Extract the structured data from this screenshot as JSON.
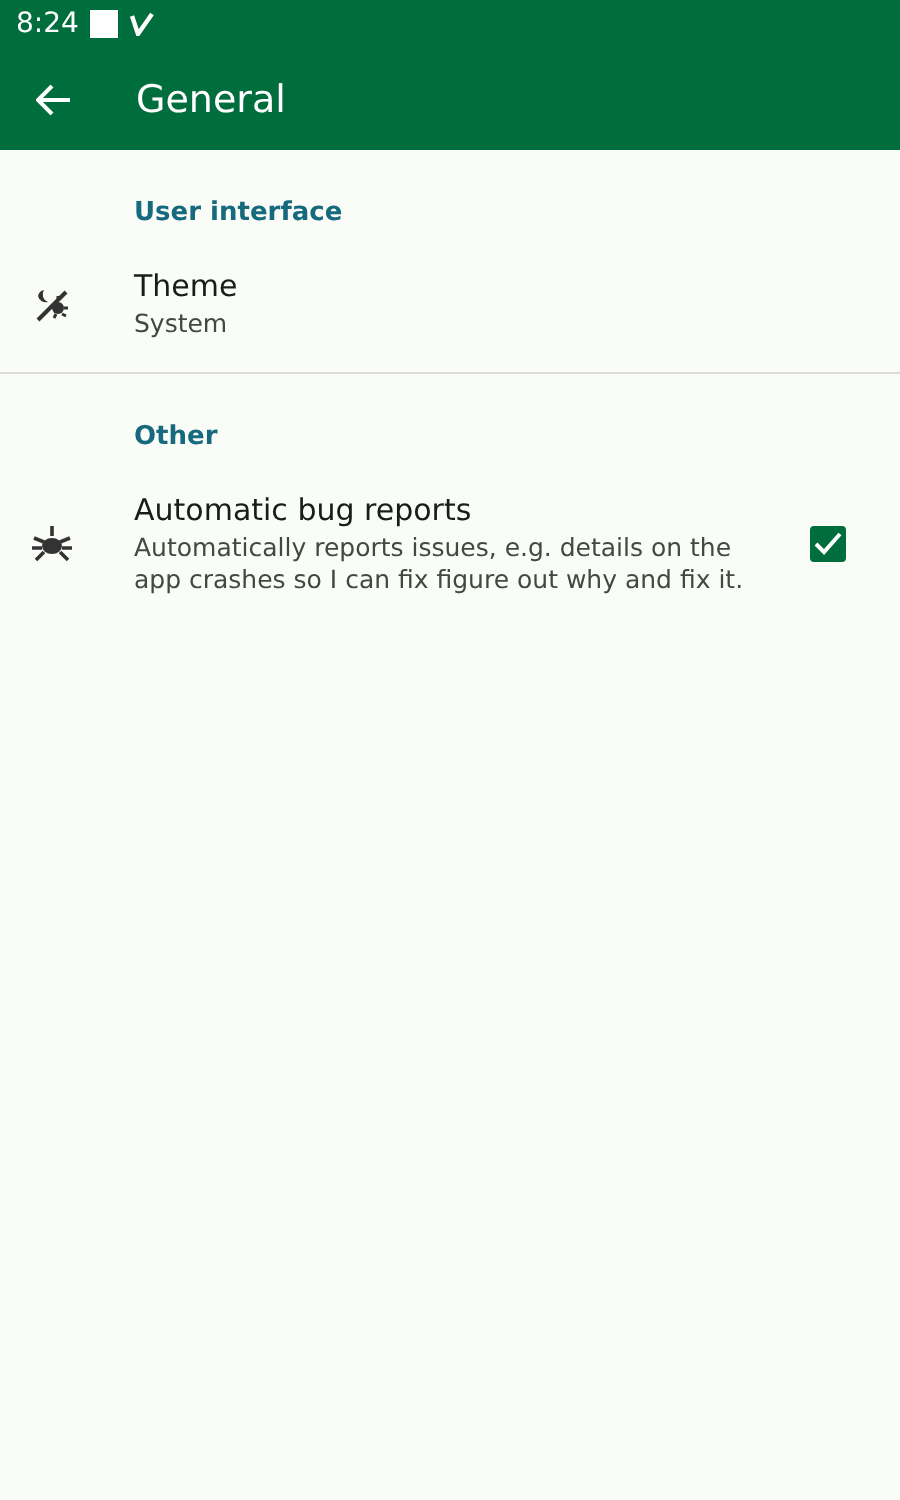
{
  "status_bar": {
    "time": "8:24"
  },
  "app_bar": {
    "title": "General"
  },
  "sections": [
    {
      "title": "User interface",
      "items": [
        {
          "kind": "value",
          "title": "Theme",
          "summary": "System"
        }
      ]
    },
    {
      "title": "Other",
      "items": [
        {
          "kind": "checkbox",
          "title": "Automatic bug reports",
          "summary": "Automatically reports issues, e.g. details on the app crashes so I can fix figure out why and fix it.",
          "checked": true
        }
      ]
    }
  ]
}
